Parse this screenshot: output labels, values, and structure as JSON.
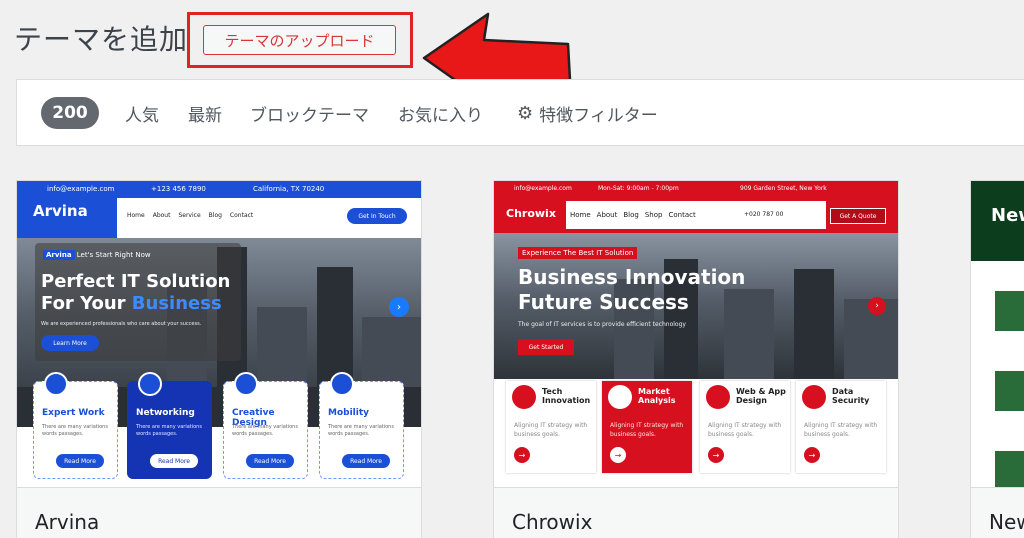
{
  "header": {
    "title": "テーマを追加",
    "upload_button": "テーマのアップロード"
  },
  "filter": {
    "count": "200",
    "tabs": [
      "人気",
      "最新",
      "ブロックテーマ",
      "お気に入り"
    ],
    "feature_filter": "特徴フィルター"
  },
  "themes": [
    {
      "name": "Arvina",
      "preview": {
        "email": "info@example.com",
        "phone": "+123 456 7890",
        "location": "California, TX 70240",
        "logo": "Arvina",
        "menu": [
          "Home",
          "About",
          "Service",
          "Blog",
          "Contact"
        ],
        "cta": "Get In Touch",
        "tag": "Arvina",
        "tagline": "Let's Start Right Now",
        "headline_line1": "Perfect IT Solution",
        "headline_line2_prefix": "For Your",
        "headline_highlight": "Business",
        "subtext": "We are experienced professionals who care about your success.",
        "learn_more": "Learn More",
        "services": [
          {
            "title": "Expert Work",
            "desc": "There are many variations words passages.",
            "button": "Read More"
          },
          {
            "title": "Networking",
            "desc": "There are many variations words passages.",
            "button": "Read More"
          },
          {
            "title": "Creative Design",
            "desc": "There are many variations words passages.",
            "button": "Read More"
          },
          {
            "title": "Mobility",
            "desc": "There are many variations words passages.",
            "button": "Read More"
          }
        ]
      }
    },
    {
      "name": "Chrowix",
      "preview": {
        "email": "info@example.com",
        "hours": "Mon-Sat: 9:00am - 7:00pm",
        "address": "909 Garden Street, New York",
        "logo": "Chrowix",
        "menu": [
          "Home",
          "About",
          "Blog",
          "Shop",
          "Contact"
        ],
        "phone": "+020 787 00",
        "cta": "Get A Quote",
        "badge": "Experience The Best IT Solution",
        "headline_line1": "Business Innovation",
        "headline_line2": "Future Success",
        "subtext": "The goal of IT services is to provide efficient technology",
        "start": "Get Started",
        "services": [
          {
            "title": "Tech\nInnovation",
            "desc": "Aligning IT strategy with business goals."
          },
          {
            "title": "Market\nAnalysis",
            "desc": "Aligning IT strategy with business goals."
          },
          {
            "title": "Web & App\nDesign",
            "desc": "Aligning IT strategy with business goals."
          },
          {
            "title": "Data\nSecurity",
            "desc": "Aligning IT strategy with business goals."
          }
        ]
      }
    },
    {
      "name": "New",
      "preview": {
        "logo": "News"
      }
    }
  ]
}
